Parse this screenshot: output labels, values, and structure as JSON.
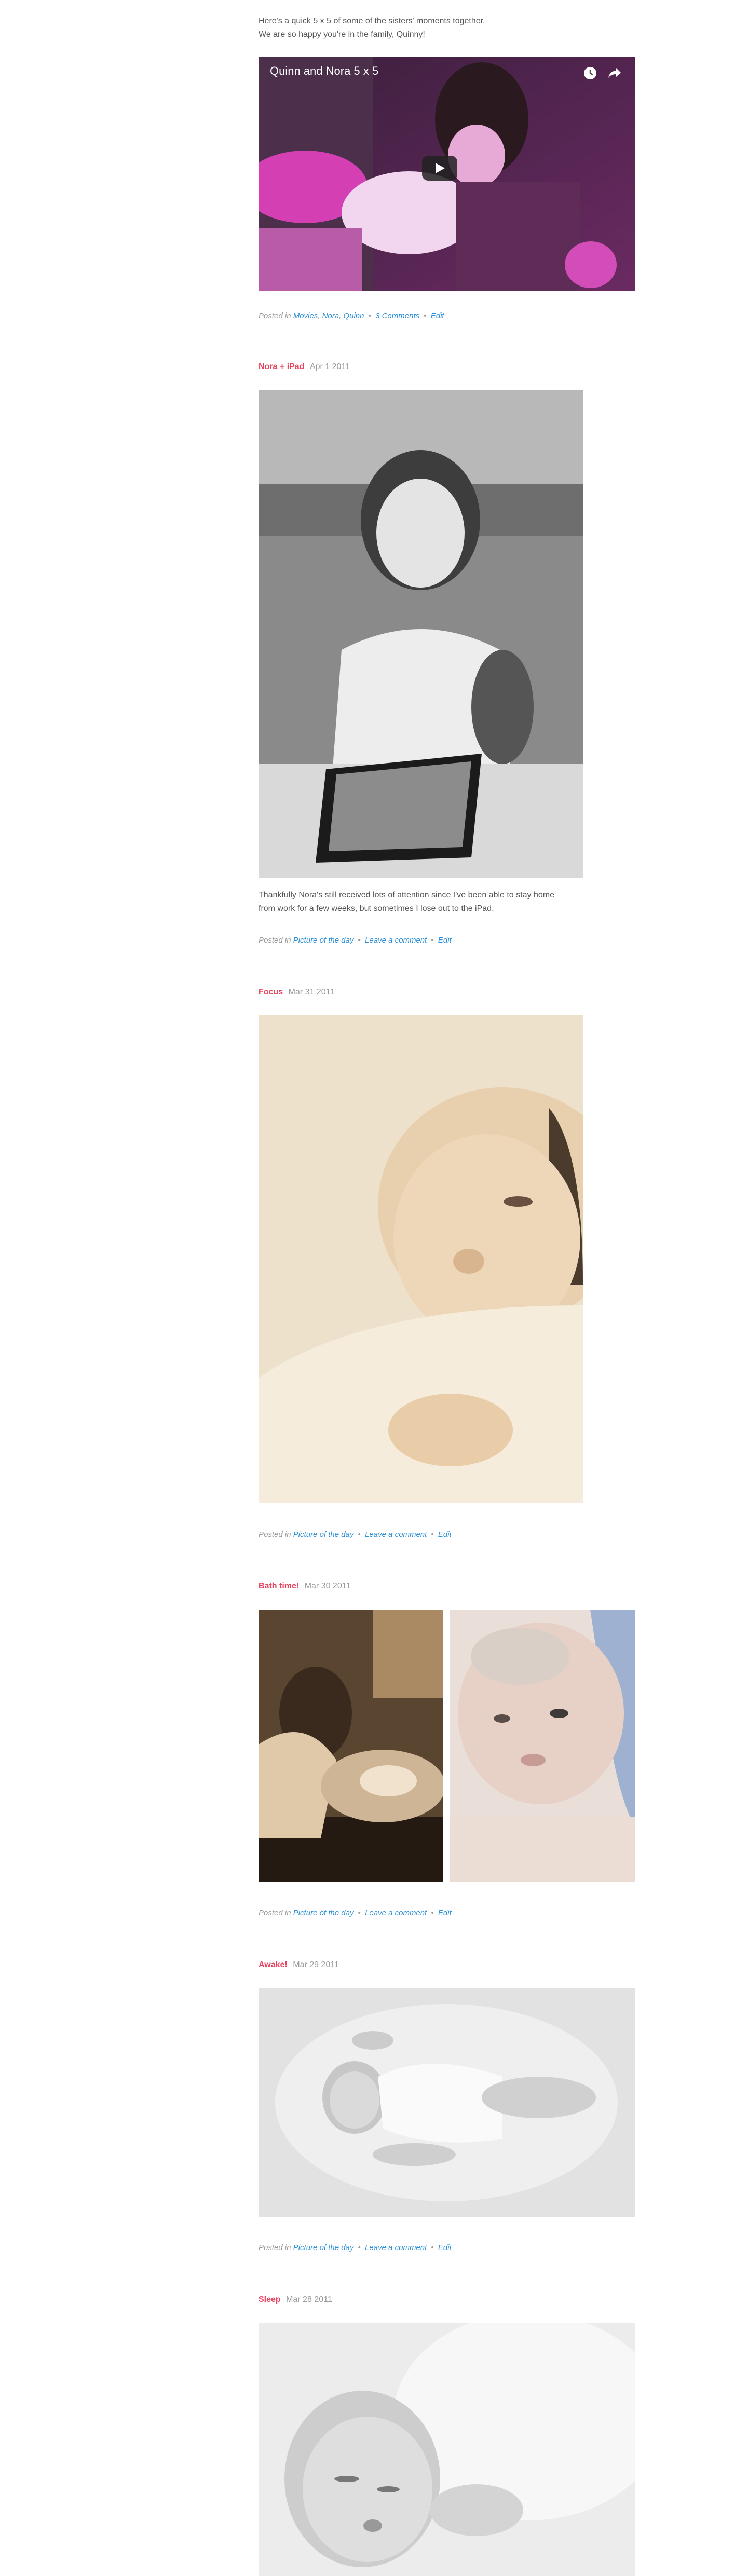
{
  "intro": {
    "line1": "Here's a quick 5 x 5 of some of the sisters' moments together.",
    "line2": "We are so happy you're in the family, Quinny!"
  },
  "video": {
    "title": "Quinn and Nora 5 x 5",
    "watch_later_icon": "clock-icon",
    "share_icon": "share-arrow-icon",
    "play_icon": "play-icon"
  },
  "post0_meta": {
    "posted_in": "Posted in",
    "cat1": "Movies",
    "cat2": "Nora",
    "cat3": "Quinn",
    "comments": "3 Comments",
    "edit": "Edit"
  },
  "posts": [
    {
      "title": "Nora + iPad",
      "date": "Apr 1 2011",
      "text_line1": "Thankfully Nora's still received lots of attention since I've been able to stay home",
      "text_line2": "from work for a few weeks, but sometimes I lose out to the iPad.",
      "posted_in": "Posted in",
      "category": "Picture of the day",
      "comment": "Leave a comment",
      "edit": "Edit"
    },
    {
      "title": "Focus",
      "date": "Mar 31 2011",
      "posted_in": "Posted in",
      "category": "Picture of the day",
      "comment": "Leave a comment",
      "edit": "Edit"
    },
    {
      "title": "Bath time!",
      "date": "Mar 30 2011",
      "posted_in": "Posted in",
      "category": "Picture of the day",
      "comment": "Leave a comment",
      "edit": "Edit"
    },
    {
      "title": "Awake!",
      "date": "Mar 29 2011",
      "posted_in": "Posted in",
      "category": "Picture of the day",
      "comment": "Leave a comment",
      "edit": "Edit"
    },
    {
      "title": "Sleep",
      "date": "Mar 28 2011"
    }
  ],
  "separator": "•",
  "colors": {
    "title": "#e8445e",
    "link": "#2a8fd8",
    "meta": "#999999",
    "text": "#555555"
  }
}
